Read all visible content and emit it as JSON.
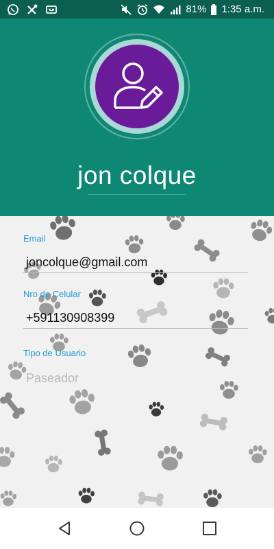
{
  "status_bar": {
    "battery": "81%",
    "time": "1:35 a.m.",
    "icons": [
      "whatsapp-icon",
      "tools-icon",
      "voicemail-icon",
      "mute-icon",
      "alarm-icon",
      "wifi-icon",
      "signal-icon",
      "battery-icon"
    ]
  },
  "profile": {
    "name": "jon colque",
    "avatar_icon": "edit-user-icon",
    "colors": {
      "header": "#0e8874",
      "status_bar": "#0a5f4e",
      "avatar": "#6a1b9a",
      "label": "#1d9ad6"
    }
  },
  "fields": {
    "email": {
      "label": "Email",
      "value": "joncolque@gmail.com"
    },
    "phone": {
      "label": "Nro de Celular",
      "value": "+591130908399"
    },
    "user_type": {
      "label": "Tipo de Usuario",
      "value": "Paseador"
    }
  },
  "nav": {
    "icons": [
      "back-icon",
      "home-icon",
      "recents-icon"
    ]
  }
}
